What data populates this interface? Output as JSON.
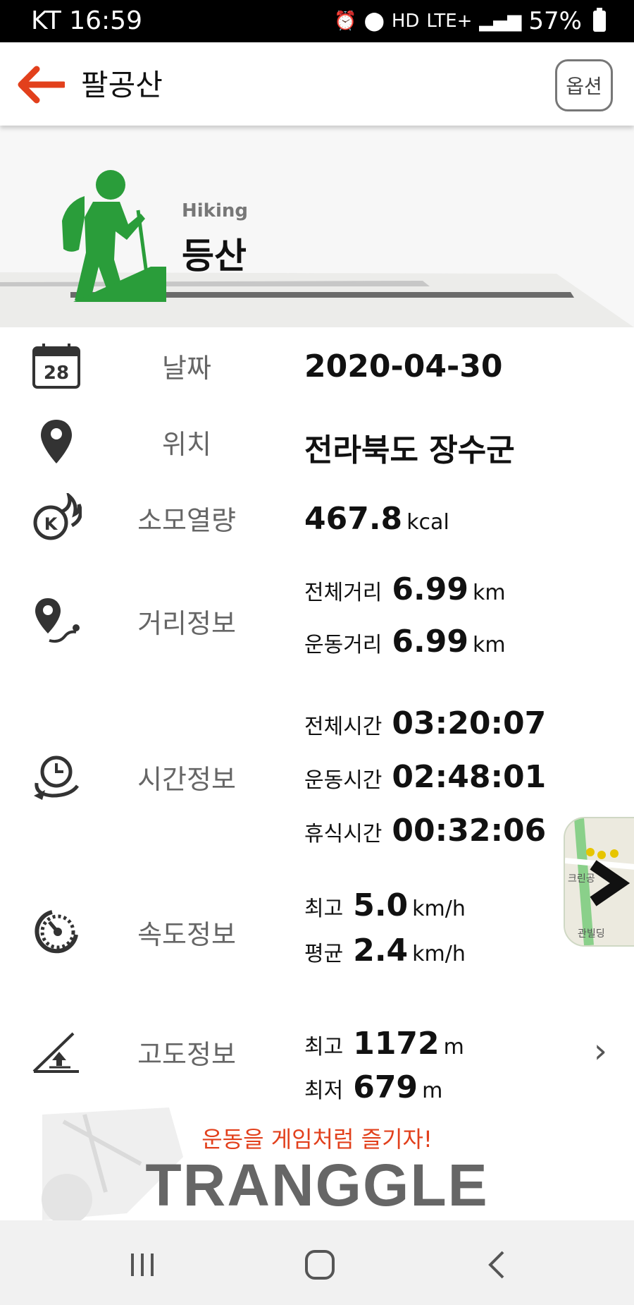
{
  "status_bar": {
    "carrier_time": "KT 16:59",
    "network": "LTE+",
    "battery": "57%",
    "hd": "HD"
  },
  "app_bar": {
    "title": "팔공산",
    "option_label": "옵션"
  },
  "hero": {
    "activity_en": "Hiking",
    "activity_ko": "등산",
    "calendar_day": "28"
  },
  "rows": {
    "date": {
      "label": "날짜",
      "value": "2020-04-30"
    },
    "location": {
      "label": "위치",
      "value": "전라북도 장수군"
    },
    "calories": {
      "label": "소모열량",
      "value": "467.8",
      "unit": "kcal",
      "icon_letter": "K"
    },
    "distance": {
      "label": "거리정보",
      "total_label": "전체거리",
      "total_value": "6.99",
      "total_unit": "km",
      "moving_label": "운동거리",
      "moving_value": "6.99",
      "moving_unit": "km"
    },
    "time": {
      "label": "시간정보",
      "total_label": "전체시간",
      "total_value": "03:20:07",
      "moving_label": "운동시간",
      "moving_value": "02:48:01",
      "rest_label": "휴식시간",
      "rest_value": "00:32:06"
    },
    "speed": {
      "label": "속도정보",
      "max_label": "최고",
      "max_value": "5.0",
      "max_unit": "km/h",
      "avg_label": "평균",
      "avg_value": "2.4",
      "avg_unit": "km/h"
    },
    "altitude": {
      "label": "고도정보",
      "max_label": "최고",
      "max_value": "1172",
      "max_unit": "m",
      "min_label": "최저",
      "min_value": "679",
      "min_unit": "m"
    }
  },
  "map_thumb": {
    "map_text_1": "크린공",
    "map_text_2": "관빌딩"
  },
  "banner": {
    "slogan": "운동을 게임처럼 즐기자!",
    "logo": "TRANGGLE"
  },
  "icons": [
    "back-arrow-icon",
    "hiker-icon",
    "calendar-icon",
    "location-pin-icon",
    "calorie-fire-icon",
    "route-icon",
    "time-clock-icon",
    "speedometer-icon",
    "altitude-icon",
    "chevron-right-icon",
    "recent-apps-icon",
    "home-icon",
    "nav-back-icon"
  ],
  "colors": {
    "accent": "#e2401c",
    "hiker_green": "#2a9d3a",
    "status_bar": "#000000"
  }
}
